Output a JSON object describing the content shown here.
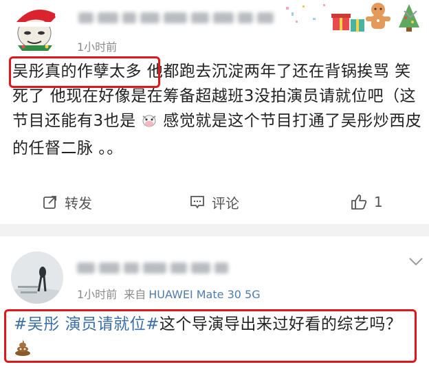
{
  "posts": [
    {
      "time": "1小时前",
      "text_highlight": "吴彤真的作孽太多",
      "text_rest": "他都跑去沉淀两年了还在背锅挨骂 笑死了 他现在好像是在筹备超越班3没拍演员请就位吧（这节目还能有3也是",
      "text_after_cow": "感觉就是这个节目打通了吴彤炒西皮的任督二脉 。。",
      "actions": {
        "repost_label": "转发",
        "comment_label": "评论",
        "like_count": "1"
      }
    },
    {
      "time": "1小时前",
      "source_prefix": "来自",
      "device": "HUAWEI Mate 30 5G",
      "topic": "#吴彤 演员请就位#",
      "text": "这个导演导出来过好看的综艺吗？"
    }
  ],
  "colors": {
    "highlight_border": "#e0161b",
    "topic_blue": "#3b6ea6",
    "divider": "#f2f2f2"
  },
  "icons": [
    "repost-icon",
    "comment-icon",
    "like-icon",
    "chevron-down-icon",
    "cow-emoji",
    "poop-emoji"
  ]
}
